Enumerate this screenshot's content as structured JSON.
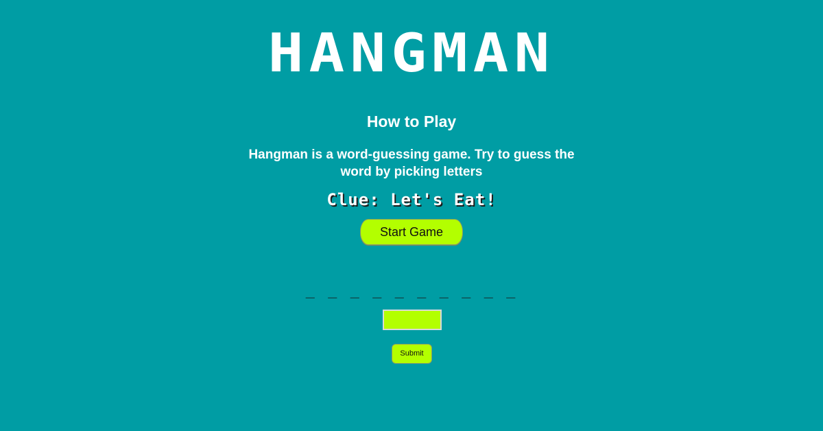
{
  "game": {
    "title": "HANGMAN"
  },
  "instructions": {
    "heading": "How to Play",
    "description": "Hangman is a word-guessing game. Try to guess the word by picking letters"
  },
  "clue": {
    "text": "Clue: Let's Eat!"
  },
  "controls": {
    "start_label": "Start Game",
    "submit_label": "Submit",
    "guess_value": ""
  },
  "word": {
    "blanks": "_ _ _ _ _ _ _ _ _ _",
    "letter_count": 10
  },
  "colors": {
    "background": "#009da4",
    "accent": "#b3ff00",
    "text": "#ffffff"
  }
}
